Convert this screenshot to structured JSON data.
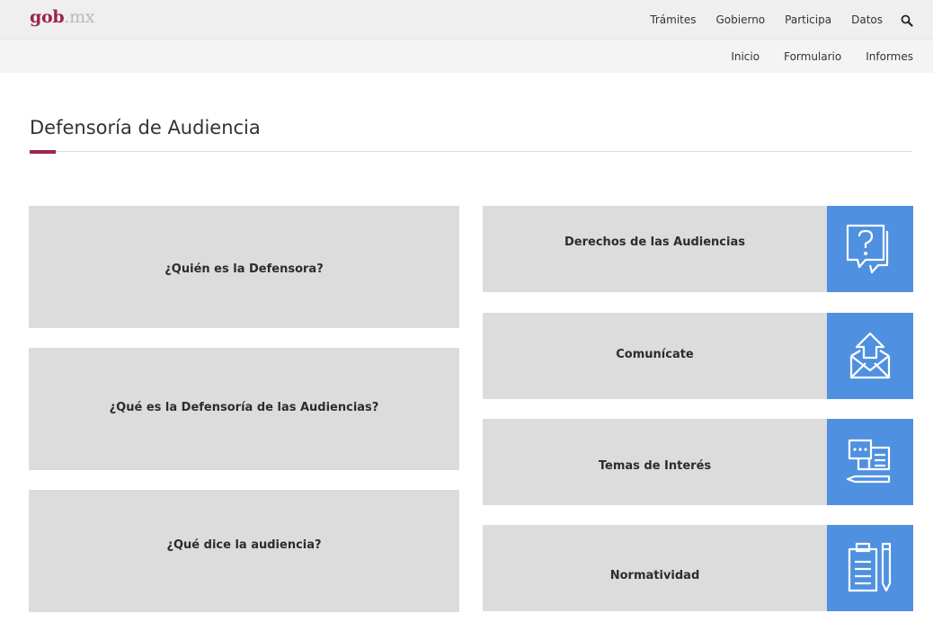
{
  "header": {
    "logo_main": "gob",
    "logo_suffix": ".mx",
    "nav": [
      "Trámites",
      "Gobierno",
      "Participa",
      "Datos"
    ]
  },
  "subnav": [
    "Inicio",
    "Formulario",
    "Informes"
  ],
  "page": {
    "title": "Defensoría de Audiencia"
  },
  "left_cards": [
    {
      "label": "¿Quién es la Defensora?"
    },
    {
      "label": "¿Qué es la Defensoría de las Audiencias?"
    },
    {
      "label": "¿Qué dice la audiencia?"
    }
  ],
  "right_cards": [
    {
      "label": "Derechos de las Audiencias",
      "icon": "question-document-icon"
    },
    {
      "label": "Comunícate",
      "icon": "envelope-upload-icon"
    },
    {
      "label": "Temas de Interés",
      "icon": "chat-pencil-icon"
    },
    {
      "label": "Normatividad",
      "icon": "clipboard-pencil-icon"
    }
  ],
  "colors": {
    "brand": "#9d2449",
    "tile": "#dcdcdc",
    "icon_bg": "#4f91e0",
    "topbar": "#efefef"
  }
}
